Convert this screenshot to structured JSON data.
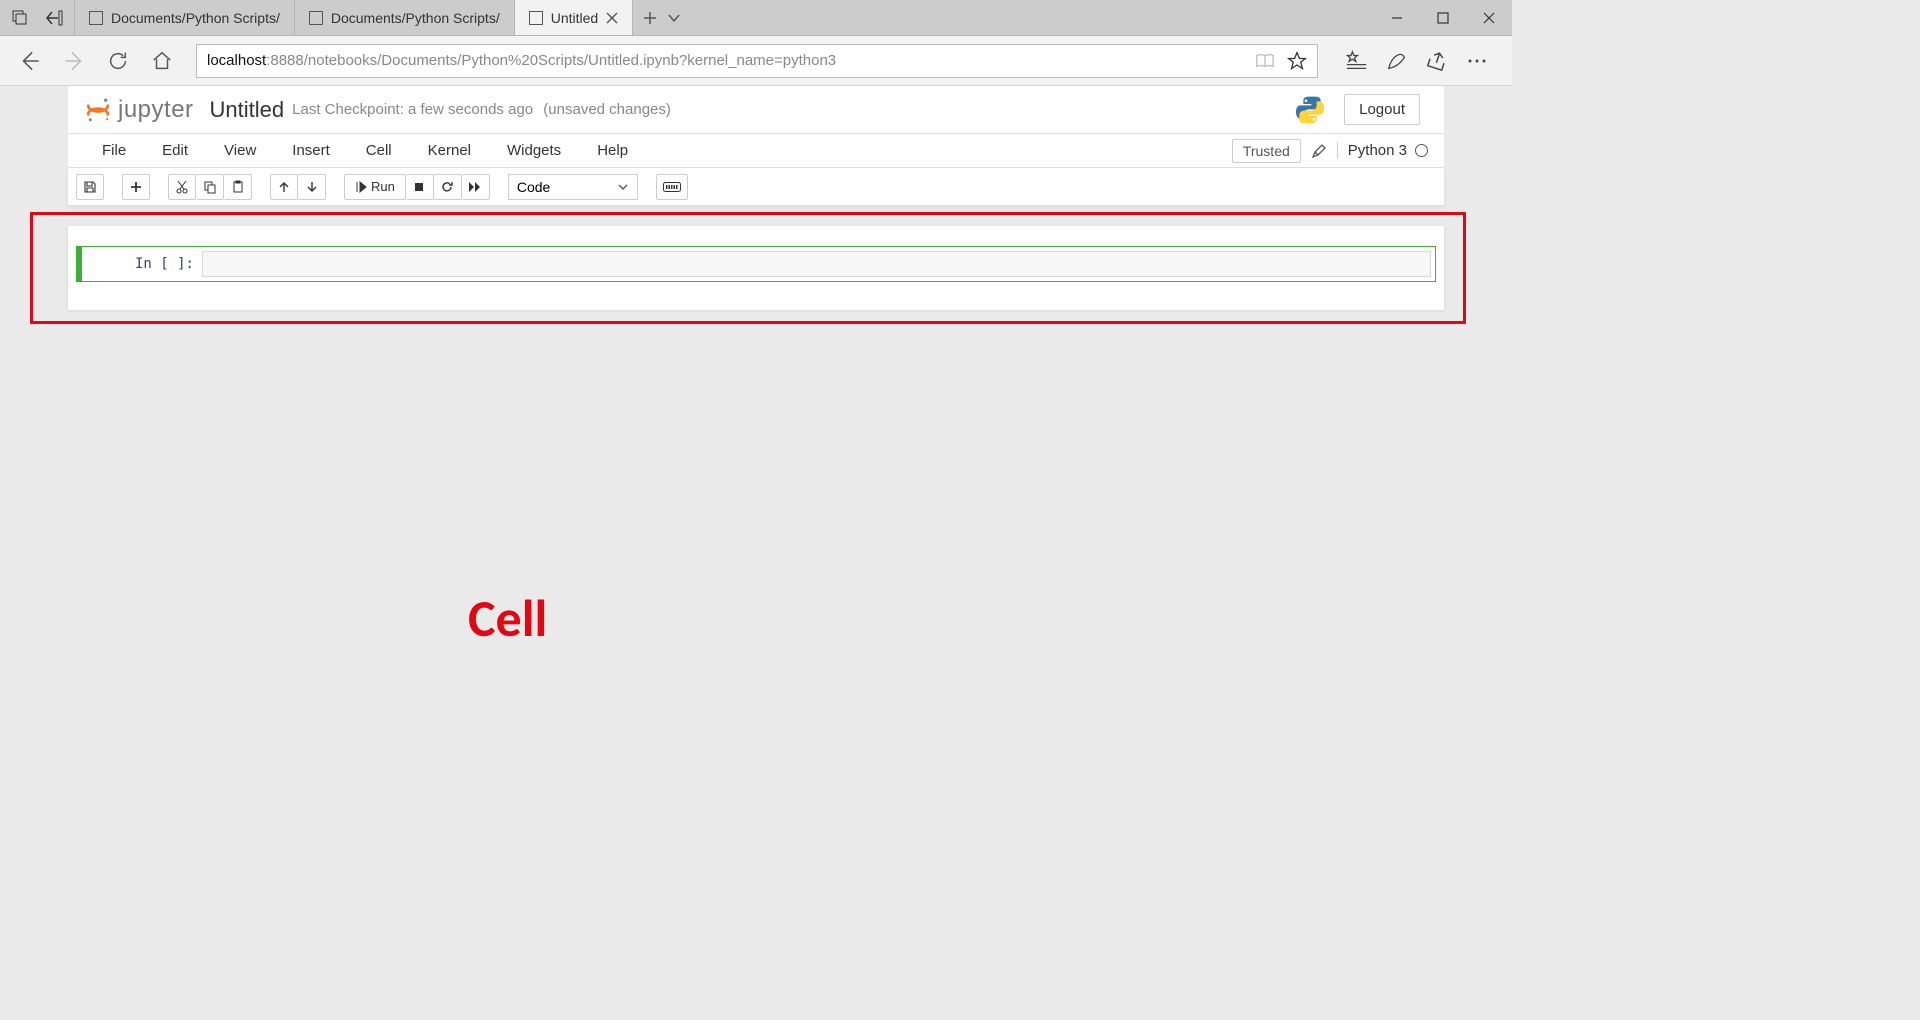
{
  "browser": {
    "tabs": [
      {
        "title": "Documents/Python Scripts/"
      },
      {
        "title": "Documents/Python Scripts/"
      },
      {
        "title": "Untitled"
      }
    ],
    "url_host": "localhost",
    "url_path": ":8888/notebooks/Documents/Python%20Scripts/Untitled.ipynb?kernel_name=python3"
  },
  "jupyter": {
    "logo_text": "jupyter",
    "title": "Untitled",
    "checkpoint_prefix": "Last Checkpoint: a few seconds ago",
    "checkpoint_suffix": "(unsaved changes)",
    "logout": "Logout",
    "menus": [
      "File",
      "Edit",
      "View",
      "Insert",
      "Cell",
      "Kernel",
      "Widgets",
      "Help"
    ],
    "trusted": "Trusted",
    "kernel": "Python 3",
    "run_label": "Run",
    "cell_type": "Code",
    "cell_prompt": "In [ ]:"
  },
  "annotation": {
    "cell_label": "Cell"
  }
}
